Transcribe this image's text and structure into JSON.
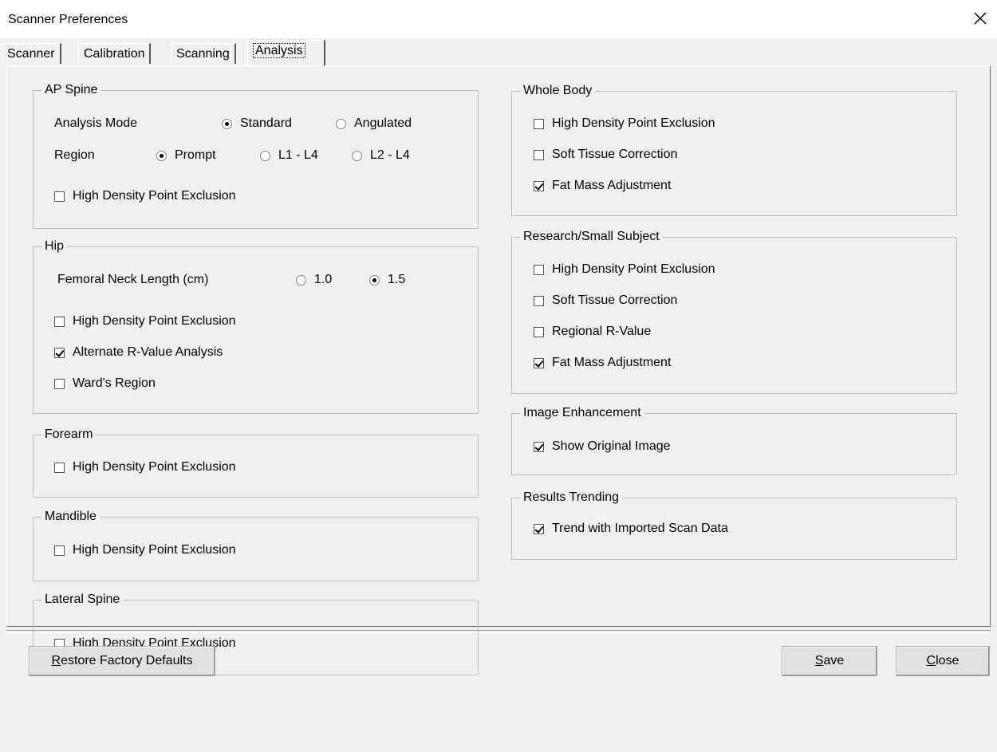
{
  "window": {
    "title": "Scanner Preferences",
    "close_glyph": "✕"
  },
  "tabs": [
    {
      "label": "Scanner",
      "active": false
    },
    {
      "label": "Calibration",
      "active": false
    },
    {
      "label": "Scanning",
      "active": false
    },
    {
      "label": "Analysis",
      "active": true
    }
  ],
  "ap_spine": {
    "title": "AP Spine",
    "mode_label": "Analysis Mode",
    "mode_options": [
      {
        "label": "Standard",
        "selected": true
      },
      {
        "label": "Angulated",
        "selected": false
      }
    ],
    "region_label": "Region",
    "region_options": [
      {
        "label": "Prompt",
        "selected": true
      },
      {
        "label": "L1 - L4",
        "selected": false
      },
      {
        "label": "L2 - L4",
        "selected": false
      }
    ],
    "hdpe": {
      "label": "High Density Point Exclusion",
      "checked": false
    }
  },
  "hip": {
    "title": "Hip",
    "neck_label": "Femoral Neck Length (cm)",
    "neck_options": [
      {
        "label": "1.0",
        "selected": false
      },
      {
        "label": "1.5",
        "selected": true
      }
    ],
    "checks": [
      {
        "label": "High Density Point Exclusion",
        "checked": false
      },
      {
        "label": "Alternate R-Value Analysis",
        "checked": true
      },
      {
        "label": "Ward's Region",
        "checked": false
      }
    ]
  },
  "forearm": {
    "title": "Forearm",
    "hdpe": {
      "label": "High Density Point Exclusion",
      "checked": false
    }
  },
  "mandible": {
    "title": "Mandible",
    "hdpe": {
      "label": "High Density Point Exclusion",
      "checked": false
    }
  },
  "lateral_spine": {
    "title": "Lateral Spine",
    "hdpe": {
      "label": "High Density Point Exclusion",
      "checked": false
    }
  },
  "whole_body": {
    "title": "Whole Body",
    "checks": [
      {
        "label": "High Density Point Exclusion",
        "checked": false
      },
      {
        "label": "Soft Tissue Correction",
        "checked": false
      },
      {
        "label": "Fat Mass Adjustment",
        "checked": true
      }
    ]
  },
  "research": {
    "title": "Research/Small Subject",
    "checks": [
      {
        "label": "High Density Point Exclusion",
        "checked": false
      },
      {
        "label": "Soft Tissue Correction",
        "checked": false
      },
      {
        "label": "Regional R-Value",
        "checked": false
      },
      {
        "label": "Fat Mass Adjustment",
        "checked": true
      }
    ]
  },
  "image_enhancement": {
    "title": "Image Enhancement",
    "check": {
      "label": "Show Original Image",
      "checked": true
    }
  },
  "results_trending": {
    "title": "Results Trending",
    "check": {
      "label": "Trend with Imported Scan Data",
      "checked": true
    }
  },
  "buttons": {
    "restore": {
      "first": "R",
      "rest": "estore Factory Defaults"
    },
    "save": {
      "first": "S",
      "rest": "ave"
    },
    "close": {
      "first": "C",
      "rest": "lose"
    }
  }
}
